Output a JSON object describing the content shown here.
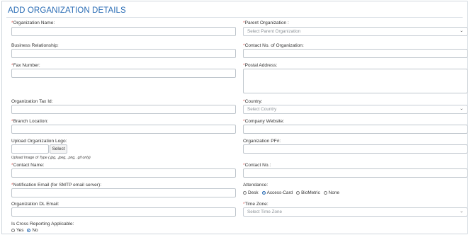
{
  "header": {
    "title": "ADD ORGANIZATION DETAILS"
  },
  "fields": {
    "org_name": {
      "label": "Organization Name:",
      "required": "*"
    },
    "parent_org": {
      "label": "Parent Organization :",
      "required": "*",
      "placeholder": "Select Parent Organization"
    },
    "business_rel": {
      "label": "Business Relationship:"
    },
    "contact_no_org": {
      "label": "Contact No. of Organization:",
      "required": "*"
    },
    "fax": {
      "label": "Fax Number:",
      "required": "*"
    },
    "postal": {
      "label": "Postal Address:",
      "required": "*"
    },
    "tax_id": {
      "label": "Organization Tax Id:"
    },
    "country": {
      "label": "Country:",
      "required": "*",
      "placeholder": "Select Country"
    },
    "branch": {
      "label": "Branch Location:",
      "required": "*"
    },
    "website": {
      "label": "Company Website:",
      "required": "*"
    },
    "logo": {
      "label": "Upload Organization Logo:",
      "button": "Select",
      "hint": "Upload Image of Type (.jpg, .jpeg, .png, .gif only)"
    },
    "pf": {
      "label": "Organization PF#:"
    },
    "contact_name": {
      "label": "Contact Name:",
      "required": "*"
    },
    "contact_no": {
      "label": "Contact No.:",
      "required": "*"
    },
    "notif_email": {
      "label": "Notification Email (for SMTP email server):",
      "required": "*"
    },
    "attendance": {
      "label": "Attendance:",
      "options": [
        "Desk",
        "Access-Card",
        "BioMetric",
        "None"
      ],
      "selected": "Access-Card"
    },
    "dl_email": {
      "label": "Organization DL Email:"
    },
    "timezone": {
      "label": "Time Zone:",
      "required": "*",
      "placeholder": "Select Time Zone"
    },
    "cross_report": {
      "label": "Is Cross Reporting Applicable:",
      "options": [
        "Yes",
        "No"
      ],
      "selected": "No"
    }
  },
  "icons": {
    "dropdown": "chevron-down-icon"
  },
  "colors": {
    "accent": "#2b6db5",
    "required": "#d9534f"
  }
}
